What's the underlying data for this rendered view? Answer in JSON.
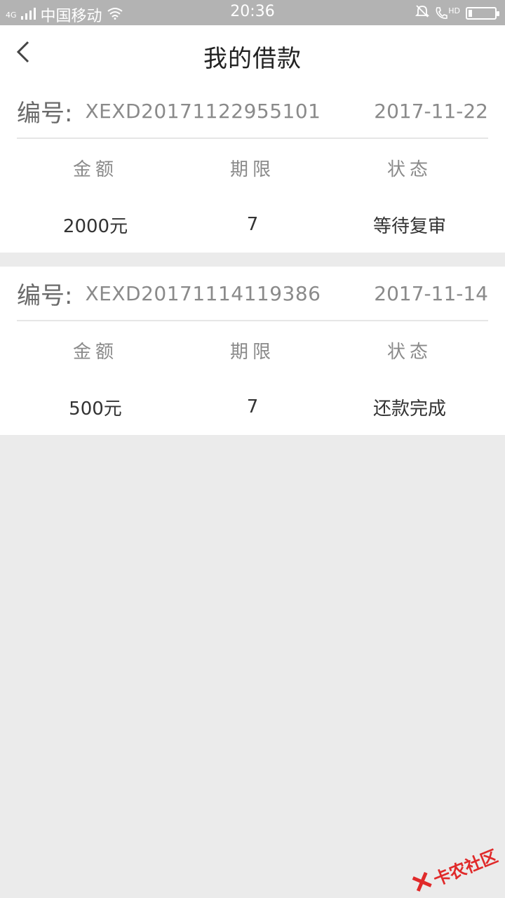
{
  "status_bar": {
    "network": "4G",
    "carrier": "中国移动",
    "time": "20:36",
    "hd": "HD",
    "battery_level": 0.15
  },
  "header": {
    "title": "我的借款"
  },
  "loans": [
    {
      "label": "编号:",
      "id": "XEXD20171122955101",
      "date": "2017-11-22",
      "headers": [
        "金额",
        "期限",
        "状态"
      ],
      "amount": "2000元",
      "term": "7",
      "status": "等待复审"
    },
    {
      "label": "编号:",
      "id": "XEXD20171114119386",
      "date": "2017-11-14",
      "headers": [
        "金额",
        "期限",
        "状态"
      ],
      "amount": "500元",
      "term": "7",
      "status": "还款完成"
    }
  ],
  "watermark": {
    "text": "卡农社区"
  },
  "colors": {
    "status_bar_bg": "#b3b3b3",
    "page_bg": "#ebebeb",
    "card_bg": "#ffffff",
    "watermark": "#e02a2a"
  }
}
